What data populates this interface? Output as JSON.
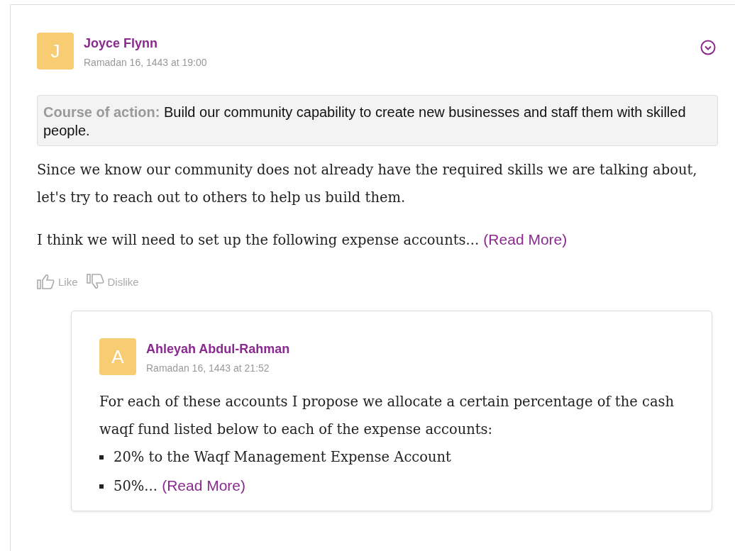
{
  "post": {
    "avatar_initial": "J",
    "author": "Joyce Flynn",
    "date": "Ramadan 16, 1443 at 19:00",
    "course_of_action": {
      "label": "Course of action:",
      "text": "Build our community capability to create new businesses and staff them with skilled people."
    },
    "paragraphs": [
      {
        "text": "Since we know our community does not already have the required skills we are talking about, let's try to reach out to others to help us build them."
      },
      {
        "text": "I think we will need to set up the following expense accounts...",
        "read_more": "(Read More)"
      }
    ],
    "reactions": [
      {
        "kind": "like",
        "label": "Like"
      },
      {
        "kind": "dislike",
        "label": "Dislike"
      }
    ],
    "replies": [
      {
        "avatar_initial": "A",
        "author": "Ahleyah Abdul-Rahman",
        "date": "Ramadan 16, 1443 at 21:52",
        "paragraph": "For each of these accounts I propose we allocate a certain percentage of the cash waqf fund listed below to each of the expense accounts:",
        "bullets": [
          {
            "text": "20% to the Waqf Management Expense Account"
          },
          {
            "text": "50%...",
            "read_more": "(Read More)"
          }
        ]
      }
    ]
  }
}
